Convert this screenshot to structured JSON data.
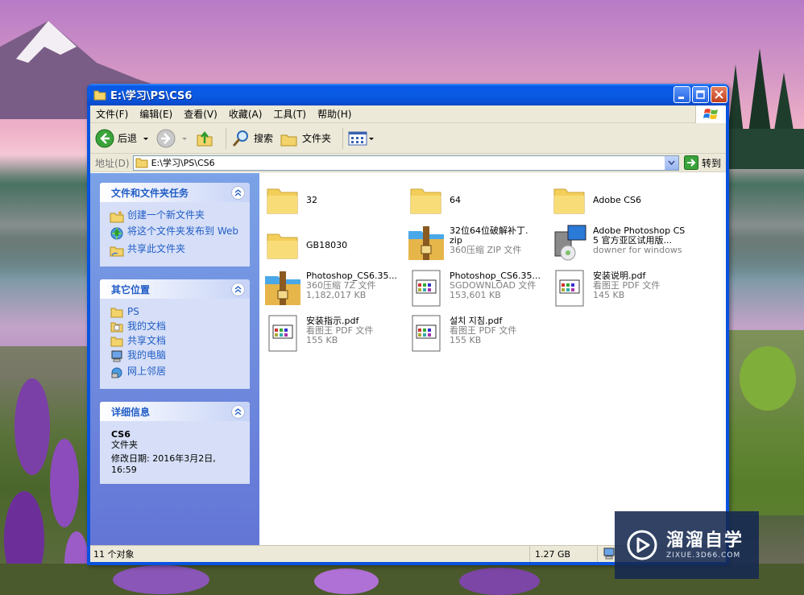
{
  "window": {
    "title": "E:\\学习\\PS\\CS6"
  },
  "menu": [
    "文件(F)",
    "编辑(E)",
    "查看(V)",
    "收藏(A)",
    "工具(T)",
    "帮助(H)"
  ],
  "toolbar": {
    "back": "后退",
    "search": "搜索",
    "folders": "文件夹"
  },
  "address": {
    "label": "地址(D)",
    "value": "E:\\学习\\PS\\CS6",
    "go": "转到"
  },
  "tasks": {
    "file_tasks": {
      "title": "文件和文件夹任务",
      "items": [
        "创建一个新文件夹",
        "将这个文件夹发布到 Web",
        "共享此文件夹"
      ]
    },
    "other_places": {
      "title": "其它位置",
      "items": [
        "PS",
        "我的文档",
        "共享文档",
        "我的电脑",
        "网上邻居"
      ]
    },
    "details": {
      "title": "详细信息",
      "name": "CS6",
      "type": "文件夹",
      "modified_label": "修改日期: 2016年3月2日,",
      "modified_time": "16:59"
    }
  },
  "files": [
    {
      "name": "32",
      "icon": "folder-icon"
    },
    {
      "name": "64",
      "icon": "folder-icon"
    },
    {
      "name": "Adobe CS6",
      "icon": "folder-icon"
    },
    {
      "name": "GB18030",
      "icon": "folder-icon"
    },
    {
      "name": "32位64位破解补丁.",
      "name2": "zip",
      "sub": "360压缩 ZIP 文件",
      "icon": "archive-icon"
    },
    {
      "name": "Adobe Photoshop CS",
      "name2": "5 官方亚区试用版...",
      "sub": "downer for windows",
      "icon": "installer-icon"
    },
    {
      "name": "Photoshop_CS6.35...",
      "sub": "360压缩 7Z 文件",
      "sub2": "1,182,017 KB",
      "icon": "archive-icon"
    },
    {
      "name": "Photoshop_CS6.35...",
      "sub": "SGDOWNLOAD 文件",
      "sub2": "153,601 KB",
      "icon": "document-icon"
    },
    {
      "name": "安装说明.pdf",
      "sub": "看图王 PDF 文件",
      "sub2": "145 KB",
      "icon": "document-icon"
    },
    {
      "name": "安装指示.pdf",
      "sub": "看图王 PDF 文件",
      "sub2": "155 KB",
      "icon": "document-icon"
    },
    {
      "name": "설치 지침.pdf",
      "sub": "看图王 PDF 文件",
      "sub2": "155 KB",
      "icon": "document-icon"
    }
  ],
  "status": {
    "count": "11 个对象",
    "size": "1.27 GB"
  },
  "watermark": {
    "main": "溜溜自学",
    "sub": "ZIXUE.3D66.COM"
  }
}
